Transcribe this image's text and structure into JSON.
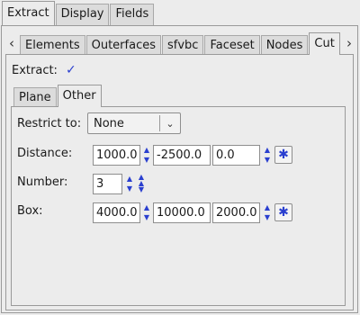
{
  "top_tabs": [
    {
      "label": "Extract",
      "active": true
    },
    {
      "label": "Display",
      "active": false
    },
    {
      "label": "Fields",
      "active": false
    }
  ],
  "sub_tabs": [
    {
      "label": "Elements",
      "active": false
    },
    {
      "label": "Outerfaces",
      "active": false
    },
    {
      "label": "sfvbc",
      "active": false
    },
    {
      "label": "Faceset",
      "active": false
    },
    {
      "label": "Nodes",
      "active": false
    },
    {
      "label": "Cut",
      "active": true
    }
  ],
  "extract": {
    "label": "Extract:",
    "checked": true
  },
  "inner_tabs": [
    {
      "label": "Plane",
      "active": false
    },
    {
      "label": "Other",
      "active": true
    }
  ],
  "form": {
    "restrict": {
      "label": "Restrict to:",
      "value": "None"
    },
    "distance": {
      "label": "Distance:",
      "x": "1000.0",
      "y": "-2500.0",
      "z": "0.0"
    },
    "number": {
      "label": "Number:",
      "value": "3"
    },
    "box": {
      "label": "Box:",
      "x": "4000.0",
      "y": "10000.0",
      "z": "2000.0"
    }
  },
  "icons": {
    "scroll_left": "chevron-left-icon",
    "scroll_right": "chevron-right-icon",
    "check": "checkmark-icon",
    "pick": "asterisk-icon"
  },
  "colors": {
    "accent": "#2a3fcf",
    "panel": "#ececec"
  }
}
